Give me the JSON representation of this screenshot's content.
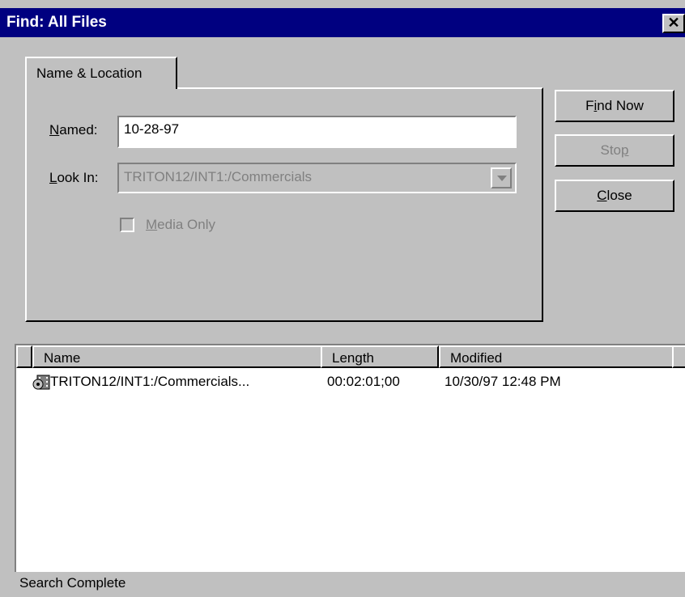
{
  "window": {
    "title": "Find: All Files",
    "close_glyph": "✕"
  },
  "tabs": [
    {
      "label": "Name & Location"
    }
  ],
  "form": {
    "named": {
      "label_underline": "N",
      "label_rest": "amed:",
      "value": "10-28-97"
    },
    "look_in": {
      "label_underline": "L",
      "label_rest": "ook In:",
      "value": "TRITON12/INT1:/Commercials"
    },
    "media_only": {
      "label_underline": "M",
      "label_rest": "edia Only",
      "checked": false,
      "enabled": false
    }
  },
  "buttons": {
    "find_now": {
      "pre": "F",
      "underline": "i",
      "post": "nd Now"
    },
    "stop": {
      "pre": "Sto",
      "underline": "p",
      "post": "",
      "enabled": false
    },
    "close": {
      "pre": "",
      "underline": "C",
      "post": "lose"
    }
  },
  "results": {
    "columns": [
      "Name",
      "Length",
      "Modified"
    ],
    "rows": [
      {
        "icon": "media-file-icon",
        "name": "TRITON12/INT1:/Commercials...",
        "length": "00:02:01;00",
        "modified": "10/30/97 12:48 PM"
      }
    ]
  },
  "status": {
    "text": "Search Complete"
  },
  "colors": {
    "titlebar": "#000080",
    "face": "#c0c0c0",
    "disabled_text": "#808080"
  }
}
